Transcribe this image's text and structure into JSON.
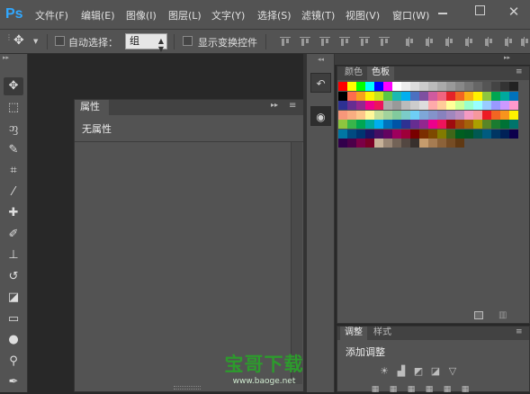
{
  "app": {
    "logo": "Ps"
  },
  "menu": [
    {
      "label": "文件(F)"
    },
    {
      "label": "编辑(E)"
    },
    {
      "label": "图像(I)"
    },
    {
      "label": "图层(L)"
    },
    {
      "label": "文字(Y)"
    },
    {
      "label": "选择(S)"
    },
    {
      "label": "滤镜(T)"
    },
    {
      "label": "视图(V)"
    },
    {
      "label": "窗口(W)"
    }
  ],
  "window": {
    "close_glyph": "✕"
  },
  "options": {
    "tool_icon": "move-tool-icon",
    "auto_select_label": "自动选择：",
    "auto_select_checked": false,
    "group_value": "组",
    "show_transform_label": "显示变换控件",
    "show_transform_checked": false
  },
  "toolbar": {
    "grip": "▸▸",
    "tools": [
      {
        "name": "move-tool-icon",
        "glyph": "✥",
        "selected": true
      },
      {
        "name": "marquee-tool-icon",
        "glyph": "⬚"
      },
      {
        "name": "lasso-tool-icon",
        "glyph": "ᦀ"
      },
      {
        "name": "quick-select-tool-icon",
        "glyph": "✎"
      },
      {
        "name": "crop-tool-icon",
        "glyph": "⌗"
      },
      {
        "name": "eyedropper-tool-icon",
        "glyph": "⁄"
      },
      {
        "name": "healing-brush-tool-icon",
        "glyph": "✚"
      },
      {
        "name": "brush-tool-icon",
        "glyph": "✐"
      },
      {
        "name": "clone-stamp-tool-icon",
        "glyph": "⊥"
      },
      {
        "name": "history-brush-tool-icon",
        "glyph": "↺"
      },
      {
        "name": "eraser-tool-icon",
        "glyph": "◪"
      },
      {
        "name": "gradient-tool-icon",
        "glyph": "▭"
      },
      {
        "name": "blur-tool-icon",
        "glyph": "●"
      },
      {
        "name": "dodge-tool-icon",
        "glyph": "⚲"
      },
      {
        "name": "pen-tool-icon",
        "glyph": "✒"
      }
    ]
  },
  "properties_panel": {
    "tab": "属性",
    "collapse_glyph": "▸▸",
    "menu_glyph": "≡",
    "empty_text": "无属性"
  },
  "dock": {
    "grip": "◂◂",
    "buttons": [
      {
        "name": "history-panel-icon",
        "glyph": "↶"
      },
      {
        "name": "swatches-panel-icon",
        "glyph": "◉"
      }
    ]
  },
  "swatch_panel": {
    "tabs": [
      {
        "label": "颜色",
        "active": false
      },
      {
        "label": "色板",
        "active": true
      }
    ],
    "menu_glyph": "≡",
    "trash_glyph": "🗑",
    "rows": [
      [
        "#ff0000",
        "#ffff00",
        "#00ff00",
        "#00ffff",
        "#0000ff",
        "#ff00ff",
        "#ffffff",
        "#eeeeee",
        "#dddddd",
        "#cccccc",
        "#bbbbbb",
        "#aaaaaa",
        "#999999",
        "#888888",
        "#777777",
        "#666666",
        "#555555",
        "#444444",
        "#333333",
        "#222222"
      ],
      [
        "#000000",
        "#ff6c4d",
        "#f7a21c",
        "#fff200",
        "#c7e51d",
        "#59c646",
        "#1ab9b2",
        "#00afef",
        "#4c70c0",
        "#7e50a0",
        "#cf5a9f",
        "#f06480",
        "#e42229",
        "#f26522",
        "#f9b114",
        "#fff200",
        "#8dc63f",
        "#00a651",
        "#00a99d",
        "#0072bc"
      ],
      [
        "#2e3192",
        "#662d91",
        "#92278f",
        "#ec008c",
        "#ed145b",
        "#aaaaaa",
        "#999999",
        "#bbbbbb",
        "#cccccc",
        "#dddddd",
        "#ffaaaa",
        "#ffcc99",
        "#ffff99",
        "#ccff99",
        "#99ffcc",
        "#99ffff",
        "#99ccff",
        "#9999ff",
        "#cc99ff",
        "#ff99cc"
      ],
      [
        "#f7977a",
        "#f9ad81",
        "#fdc68a",
        "#fff79a",
        "#c4df9b",
        "#a2d39c",
        "#82ca9d",
        "#7bcdc8",
        "#6ecff6",
        "#7ea7d8",
        "#8493ca",
        "#8882be",
        "#a187be",
        "#bc8dbf",
        "#f49ac2",
        "#f6989d",
        "#ed1c24",
        "#f26522",
        "#f7941d",
        "#fff200"
      ],
      [
        "#8dc63f",
        "#39b54a",
        "#00a651",
        "#00a99d",
        "#00aeef",
        "#0072bc",
        "#0054a6",
        "#2e3192",
        "#662d91",
        "#92278f",
        "#ec008c",
        "#ed145b",
        "#9e0b0f",
        "#a0410d",
        "#a3620a",
        "#aba000",
        "#598527",
        "#1a7b30",
        "#007236",
        "#00746b"
      ],
      [
        "#0076a3",
        "#004a80",
        "#003471",
        "#1b1464",
        "#440e62",
        "#630460",
        "#9e005d",
        "#9e0039",
        "#790000",
        "#7b2e00",
        "#7d4900",
        "#827b00",
        "#406618",
        "#005e20",
        "#005826",
        "#005952",
        "#005b7f",
        "#003663",
        "#002157",
        "#0d004c"
      ],
      [
        "#32004b",
        "#4b0049",
        "#7b0046",
        "#7a0026",
        "#c7b299",
        "#998675",
        "#736357",
        "#534741",
        "#37302d",
        "#c69c6d",
        "#a67c52",
        "#8c6239",
        "#754c24",
        "#603913"
      ]
    ]
  },
  "adjust_panel": {
    "tabs": [
      {
        "label": "调整",
        "active": true
      },
      {
        "label": "样式",
        "active": false
      }
    ],
    "menu_glyph": "≡",
    "title": "添加调整",
    "icons": [
      {
        "name": "brightness-icon",
        "glyph": "☀"
      },
      {
        "name": "levels-icon",
        "glyph": "▟"
      },
      {
        "name": "curves-icon",
        "glyph": "◩"
      },
      {
        "name": "exposure-icon",
        "glyph": "◪"
      },
      {
        "name": "vibrance-icon",
        "glyph": "▽"
      }
    ],
    "icons_row2": [
      {
        "name": "hue-saturation-icon",
        "glyph": "▦"
      },
      {
        "name": "color-balance-icon",
        "glyph": "▦"
      },
      {
        "name": "black-white-icon",
        "glyph": "▦"
      },
      {
        "name": "photo-filter-icon",
        "glyph": "▦"
      },
      {
        "name": "channel-mixer-icon",
        "glyph": "▦"
      },
      {
        "name": "color-lookup-icon",
        "glyph": "▦"
      }
    ]
  },
  "watermark": {
    "text": "宝哥下载",
    "url": "www.baoge.net"
  }
}
